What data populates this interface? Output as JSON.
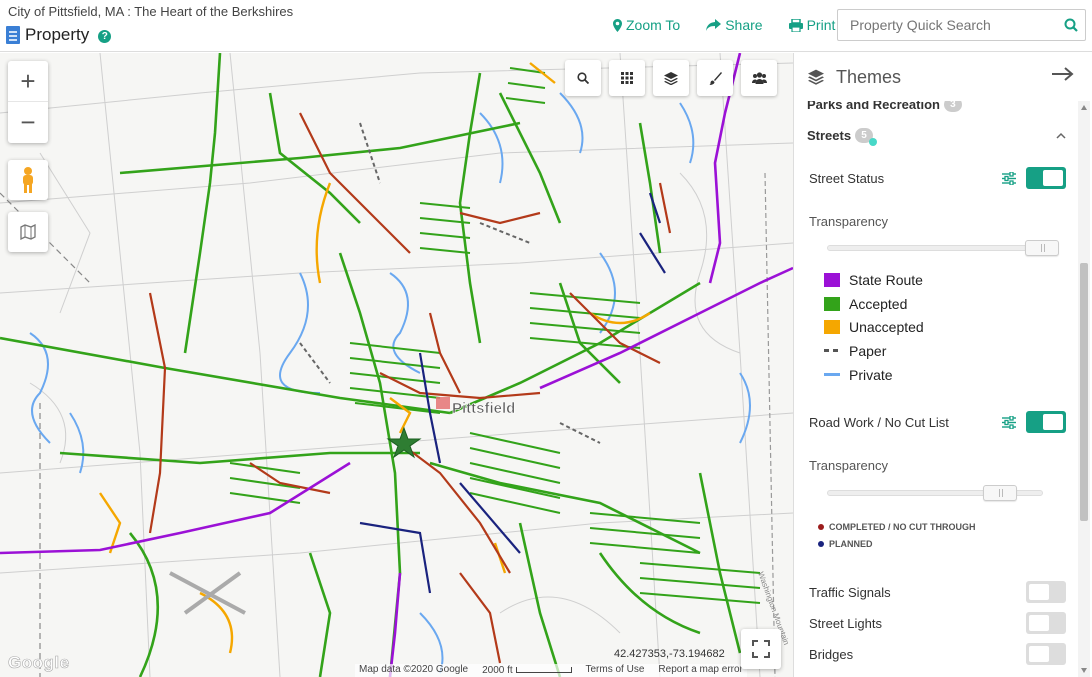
{
  "header": {
    "city_title": "City of Pittsfield, MA : The Heart of the Berkshires",
    "app_name": "Property",
    "links": {
      "zoom_to": "Zoom To",
      "share": "Share",
      "print": "Print"
    },
    "search_placeholder": "Property Quick Search",
    "accent_color": "#16a085"
  },
  "map": {
    "city_label": "Pittsfield",
    "coordinates": "42.427353,-73.194682",
    "attribution": {
      "map_data": "Map data ©2020 Google",
      "scale": "2000 ft",
      "terms": "Terms of Use",
      "report": "Report a map error"
    },
    "google_logo": "Google",
    "tool_icons": [
      "search-icon",
      "grid-icon",
      "layers-icon",
      "brush-icon",
      "group-icon"
    ]
  },
  "panel": {
    "title": "Themes",
    "sections": {
      "parks": {
        "label": "Parks and Recreation",
        "count": "3"
      },
      "streets": {
        "label": "Streets",
        "count": "5"
      }
    },
    "layers": {
      "street_status": {
        "label": "Street Status",
        "on": true
      },
      "street_status_transparency": {
        "label": "Transparency",
        "value": 0.95
      },
      "road_work": {
        "label": "Road Work / No Cut List",
        "on": true
      },
      "road_work_transparency": {
        "label": "Transparency",
        "value": 0.8
      },
      "traffic_signals": {
        "label": "Traffic Signals",
        "on": false
      },
      "street_lights": {
        "label": "Street Lights",
        "on": false
      },
      "bridges": {
        "label": "Bridges",
        "on": false
      }
    },
    "street_legend": [
      {
        "label": "State Route",
        "color": "#9b11d6",
        "style": "box"
      },
      {
        "label": "Accepted",
        "color": "#33a31a",
        "style": "box"
      },
      {
        "label": "Unaccepted",
        "color": "#f5a700",
        "style": "box"
      },
      {
        "label": "Paper",
        "color": "#555555",
        "style": "dash"
      },
      {
        "label": "Private",
        "color": "#6aa8f0",
        "style": "line"
      }
    ],
    "roadwork_legend": [
      {
        "label": "COMPLETED / NO CUT THROUGH",
        "color": "#9b1c1c"
      },
      {
        "label": "PLANNED",
        "color": "#1a237e"
      }
    ]
  }
}
